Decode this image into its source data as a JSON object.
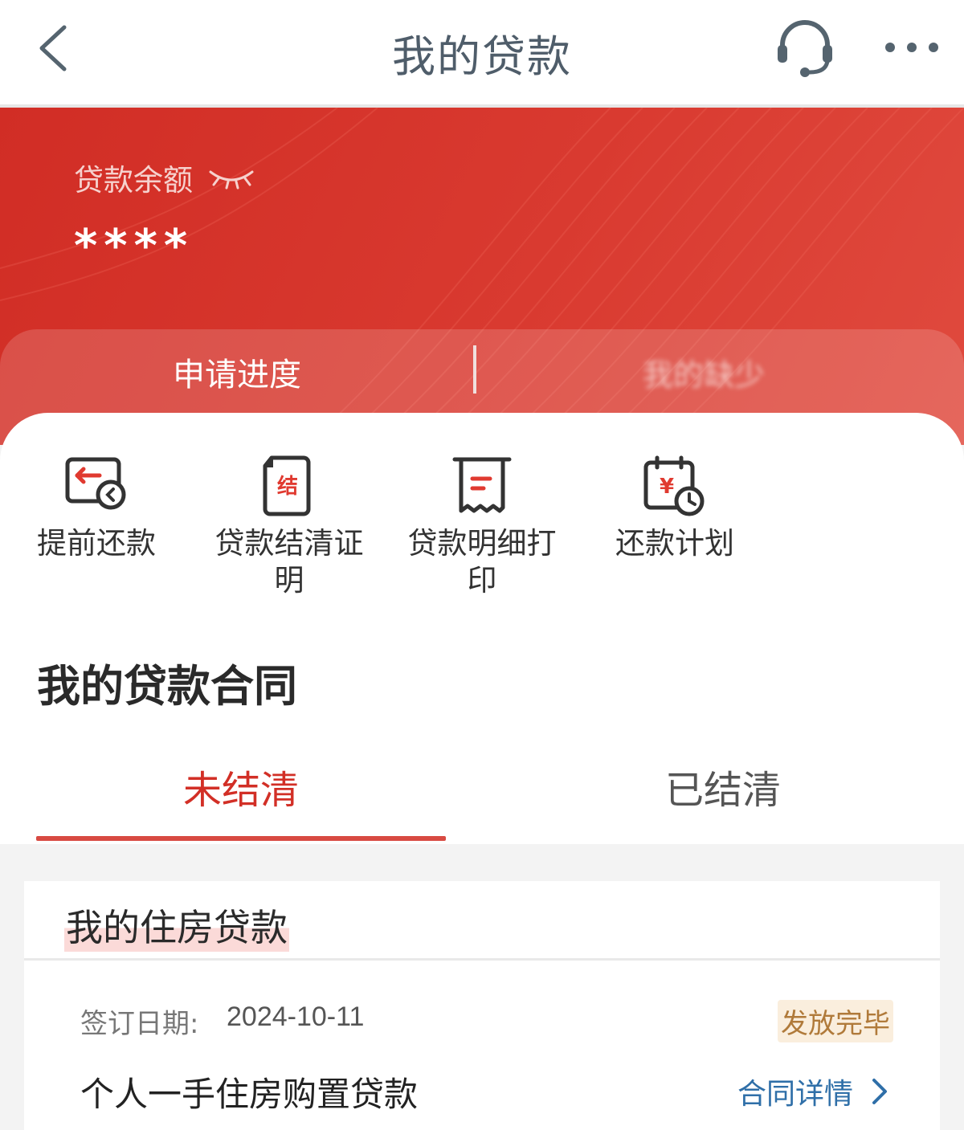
{
  "header": {
    "title": "我的贷款",
    "icons": {
      "back": "back-arrow-icon",
      "service": "headset-icon",
      "more": "more-dots-icon"
    }
  },
  "balance": {
    "label": "贷款余额",
    "masked_value": "****",
    "eye_icon": "eye-closed-icon"
  },
  "banner_tabs": {
    "progress": "申请进度",
    "second_obscured": "我的缺少"
  },
  "quick_actions": [
    {
      "label_line1": "提前还款",
      "label_line2": "",
      "icon": "early-repay-icon"
    },
    {
      "label_line1": "贷款结清证",
      "label_line2": "明",
      "icon": "settlement-cert-icon",
      "icon_text": "结"
    },
    {
      "label_line1": "贷款明细打",
      "label_line2": "印",
      "icon": "receipt-print-icon"
    },
    {
      "label_line1": "还款计划",
      "label_line2": "",
      "icon": "repay-plan-icon",
      "icon_text": "¥"
    }
  ],
  "contracts": {
    "title": "我的贷款合同",
    "tabs": {
      "active": "未结清",
      "inactive": "已结清"
    }
  },
  "loan": {
    "group_title": "我的住房贷款",
    "sign_label": "签订日期:",
    "sign_date": "2024-10-11",
    "status": "发放完毕",
    "name": "个人一手住房购置贷款",
    "detail_link": "合同详情"
  },
  "colors": {
    "brand_red": "#d12d25",
    "active_tab": "#d22f26",
    "link_blue": "#2f6fa8",
    "badge_text": "#b07a3a",
    "badge_bg": "#faeedd"
  }
}
